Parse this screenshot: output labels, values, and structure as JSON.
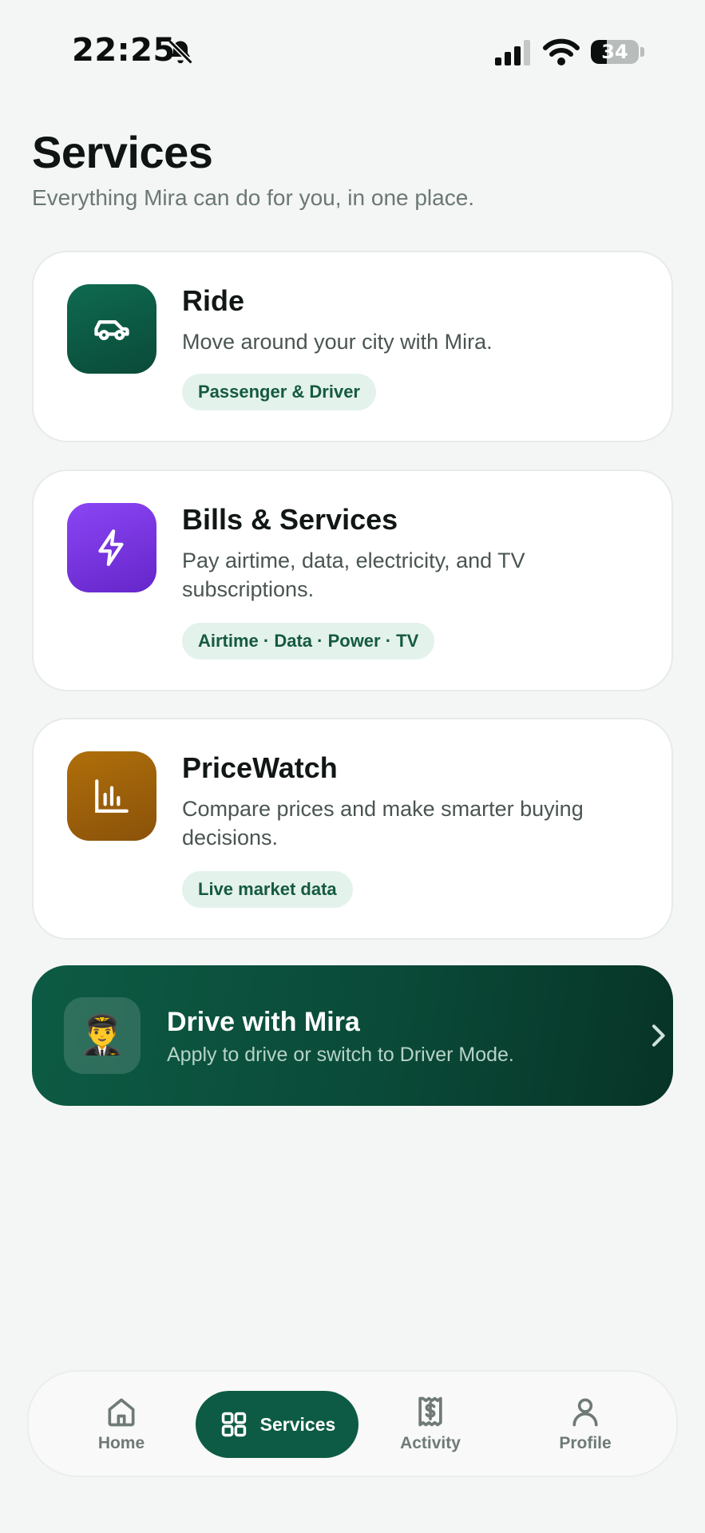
{
  "status_bar": {
    "time": "22:25",
    "battery": "34"
  },
  "header": {
    "title": "Services",
    "subtitle": "Everything Mira can do for you, in one place."
  },
  "services": [
    {
      "title": "Ride",
      "description": "Move around your city with Mira.",
      "tag": "Passenger & Driver",
      "icon": "car-icon",
      "color": "#0d5b44"
    },
    {
      "title": "Bills & Services",
      "description": "Pay airtime, data, electricity, and TV subscriptions.",
      "tag": "Airtime · Data · Power · TV",
      "icon": "lightning-icon",
      "color": "#7c3aed"
    },
    {
      "title": "PriceWatch",
      "description": "Compare prices and make smarter buying decisions.",
      "tag": "Live market data",
      "icon": "bar-chart-icon",
      "color": "#a16207"
    }
  ],
  "drive_banner": {
    "title": "Drive with Mira",
    "subtitle": "Apply to drive or switch to Driver Mode.",
    "emoji": "👨‍✈️"
  },
  "nav": {
    "home": "Home",
    "services": "Services",
    "activity": "Activity",
    "profile": "Profile"
  },
  "colors": {
    "brand": "#0d5b44",
    "background": "#f4f6f5",
    "tag_bg": "#e4f2ec"
  }
}
